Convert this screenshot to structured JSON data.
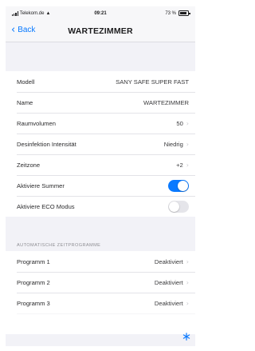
{
  "status_bar": {
    "carrier": "Telekom.de",
    "time": "09:21",
    "battery": "73 %"
  },
  "nav": {
    "back_label": "Back",
    "title": "WARTEZIMMER"
  },
  "settings": [
    {
      "label": "Modell",
      "value": "SANY SAFE SUPER FAST",
      "chevron": false
    },
    {
      "label": "Name",
      "value": "WARTEZIMMER",
      "chevron": false
    },
    {
      "label": "Raumvolumen",
      "value": "50",
      "chevron": true
    },
    {
      "label": "Desinfektion Intensität",
      "value": "Niedrig",
      "chevron": true
    },
    {
      "label": "Zeitzone",
      "value": "+2",
      "chevron": true
    }
  ],
  "toggles": [
    {
      "label": "Aktiviere Summer",
      "on": true
    },
    {
      "label": "Aktiviere ECO Modus",
      "on": false
    }
  ],
  "section_header": "AUTOMATISCHE ZEITPROGRAMME",
  "programs": [
    {
      "label": "Programm 1",
      "value": "Deaktiviert"
    },
    {
      "label": "Programm 2",
      "value": "Deaktiviert"
    },
    {
      "label": "Programm 3",
      "value": "Deaktiviert"
    }
  ],
  "colors": {
    "accent": "#0a7aff",
    "background": "#f2f2f7"
  },
  "icons": {
    "corner": "snowflake-icon"
  }
}
